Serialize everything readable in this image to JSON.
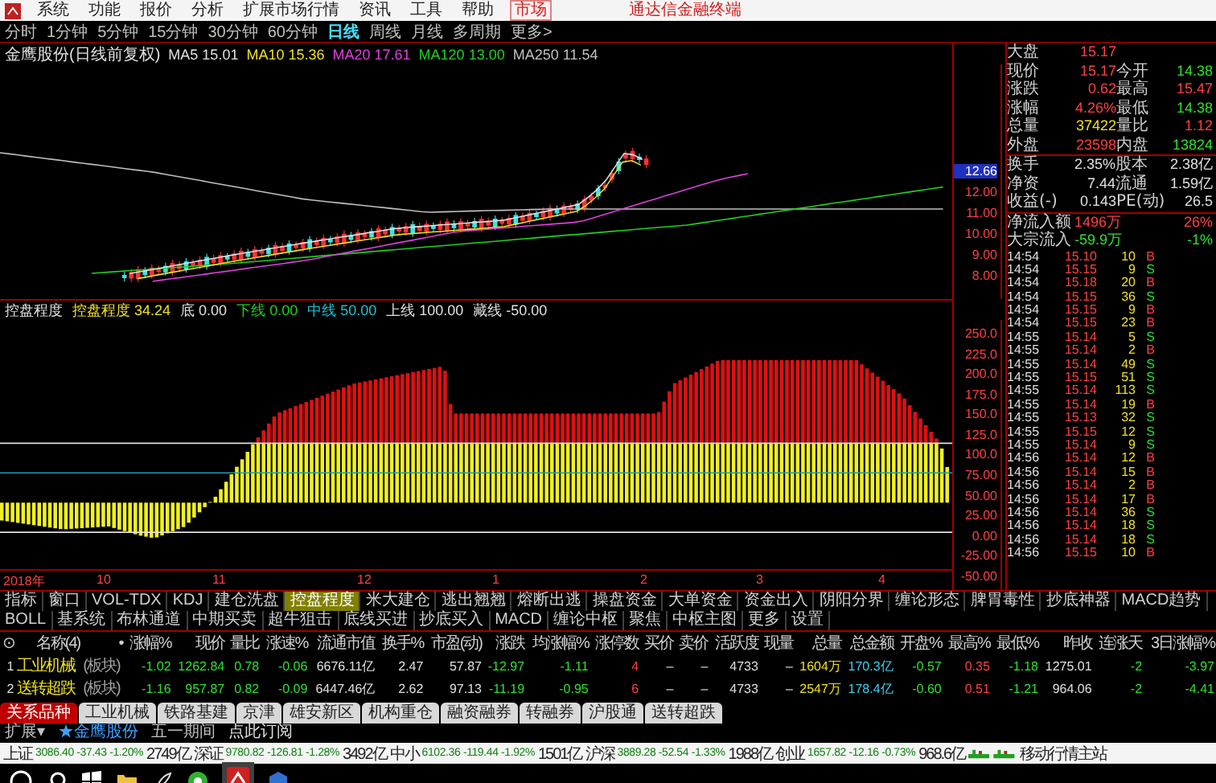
{
  "menu": {
    "items": [
      {
        "label": "系统",
        "selected": false
      },
      {
        "label": "功能",
        "selected": false
      },
      {
        "label": "报价",
        "selected": false
      },
      {
        "label": "分析",
        "selected": false
      },
      {
        "label": "扩展市场行情",
        "selected": false
      },
      {
        "label": "资讯",
        "selected": false
      },
      {
        "label": "工具",
        "selected": false
      },
      {
        "label": "帮助",
        "selected": false
      },
      {
        "label": "市场",
        "selected": true
      }
    ],
    "product": "通达信金融终端"
  },
  "periods": [
    {
      "label": "分时",
      "selected": false
    },
    {
      "label": "1分钟",
      "selected": false
    },
    {
      "label": "5分钟",
      "selected": false
    },
    {
      "label": "15分钟",
      "selected": false
    },
    {
      "label": "30分钟",
      "selected": false
    },
    {
      "label": "60分钟",
      "selected": false
    },
    {
      "label": "日线",
      "selected": true
    },
    {
      "label": "周线",
      "selected": false
    },
    {
      "label": "月线",
      "selected": false
    },
    {
      "label": "多周期",
      "selected": false
    },
    {
      "label": "更多>",
      "selected": false
    }
  ],
  "chart": {
    "title": "金鹰股份(日线前复权)",
    "mas": [
      {
        "label": "MA5 15.01",
        "color": "#e0e0e0"
      },
      {
        "label": "MA10 15.36",
        "color": "#f0e020"
      },
      {
        "label": "MA20 17.61",
        "color": "#e040e0"
      },
      {
        "label": "MA120 13.00",
        "color": "#20d020"
      },
      {
        "label": "MA250 11.54",
        "color": "#c0c0c0"
      }
    ],
    "axis": [
      {
        "label": "12.66",
        "selected": true
      },
      {
        "label": "12.00",
        "selected": false
      },
      {
        "label": "11.00",
        "selected": false
      },
      {
        "label": "10.00",
        "selected": false
      },
      {
        "label": "9.00",
        "selected": false
      },
      {
        "label": "8.00",
        "selected": false
      }
    ]
  },
  "indicator": {
    "name": "控盘程度",
    "lines": [
      {
        "label": "控盘程度 34.24",
        "color": "#f0e020"
      },
      {
        "label": "底 0.00",
        "color": "#e0e0e0"
      },
      {
        "label": "下线 0.00",
        "color": "#20d020"
      },
      {
        "label": "中线 50.00",
        "color": "#20c0d0"
      },
      {
        "label": "上线 100.00",
        "color": "#e0e0e0"
      },
      {
        "label": "藏线 -50.00",
        "color": "#e0e0e0"
      }
    ],
    "axis": [
      "250.0",
      "225.0",
      "200.0",
      "175.0",
      "150.0",
      "125.0",
      "100.0",
      "75.00",
      "50.00",
      "25.00",
      "0.00",
      "-25.00",
      "-50.00"
    ]
  },
  "dates": [
    "2018年",
    "10",
    "11",
    "12",
    "1",
    "2",
    "3",
    "4"
  ],
  "quote": {
    "rows": [
      {
        "cells": [
          {
            "label": "大盘",
            "value": "15.17",
            "color": "#ff4040"
          }
        ]
      },
      {
        "cells": [
          {
            "label": "现价",
            "value": "15.17",
            "color": "#ff4040"
          },
          {
            "label": "今开",
            "value": "14.38",
            "color": "#30e030"
          }
        ]
      },
      {
        "cells": [
          {
            "label": "涨跌",
            "value": "0.62",
            "color": "#ff4040"
          },
          {
            "label": "最高",
            "value": "15.47",
            "color": "#ff4040"
          }
        ]
      },
      {
        "cells": [
          {
            "label": "涨幅",
            "value": "4.26%",
            "color": "#ff4040"
          },
          {
            "label": "最低",
            "value": "14.38",
            "color": "#30e030"
          }
        ]
      },
      {
        "cells": [
          {
            "label": "总量",
            "value": "37422",
            "color": "#f0e020"
          },
          {
            "label": "量比",
            "value": "1.12",
            "color": "#ff4040"
          }
        ]
      },
      {
        "cells": [
          {
            "label": "外盘",
            "value": "23598",
            "color": "#ff4040"
          },
          {
            "label": "内盘",
            "value": "13824",
            "color": "#30e030"
          }
        ]
      },
      {
        "cells": [
          {
            "label": "换手",
            "value": "2.35%",
            "color": "#e0e0e0"
          },
          {
            "label": "股本",
            "value": "2.38亿",
            "color": "#e0e0e0"
          }
        ]
      },
      {
        "cells": [
          {
            "label": "净资",
            "value": "7.44",
            "color": "#e0e0e0"
          },
          {
            "label": "流通",
            "value": "1.59亿",
            "color": "#e0e0e0"
          }
        ]
      },
      {
        "cells": [
          {
            "label": "收益(-)",
            "value": "0.143",
            "color": "#e0e0e0"
          },
          {
            "label": "PE(动)",
            "value": "26.5",
            "color": "#e0e0e0"
          }
        ]
      },
      {
        "cells": [
          {
            "label": "净流入额",
            "value": "1496万",
            "color": "#ff4040"
          },
          {
            "value": "26%",
            "color": "#ff4040"
          }
        ]
      },
      {
        "cells": [
          {
            "label": "大宗流入",
            "value": "-59.9万",
            "color": "#30e030"
          },
          {
            "value": "-1%",
            "color": "#30e030"
          }
        ]
      }
    ],
    "ticks": [
      {
        "time": "14:54",
        "price": "15.10",
        "volume": "10",
        "side": "B",
        "kind": "buy"
      },
      {
        "time": "14:54",
        "price": "15.15",
        "volume": "9",
        "side": "S",
        "kind": "sell"
      },
      {
        "time": "14:54",
        "price": "15.18",
        "volume": "20",
        "side": "B",
        "kind": "buy"
      },
      {
        "time": "14:54",
        "price": "15.15",
        "volume": "36",
        "side": "S",
        "kind": "sell"
      },
      {
        "time": "14:54",
        "price": "15.15",
        "volume": "9",
        "side": "B",
        "kind": "buy"
      },
      {
        "time": "14:54",
        "price": "15.15",
        "volume": "23",
        "side": "B",
        "kind": "buy"
      },
      {
        "time": "14:55",
        "price": "15.14",
        "volume": "5",
        "side": "S",
        "kind": "sell"
      },
      {
        "time": "14:55",
        "price": "15.14",
        "volume": "2",
        "side": "B",
        "kind": "buy"
      },
      {
        "time": "14:55",
        "price": "15.14",
        "volume": "49",
        "side": "S",
        "kind": "sell"
      },
      {
        "time": "14:55",
        "price": "15.15",
        "volume": "51",
        "side": "S",
        "kind": "sell"
      },
      {
        "time": "14:55",
        "price": "15.14",
        "volume": "113",
        "side": "S",
        "kind": "sell"
      },
      {
        "time": "14:55",
        "price": "15.14",
        "volume": "19",
        "side": "B",
        "kind": "buy"
      },
      {
        "time": "14:55",
        "price": "15.13",
        "volume": "32",
        "side": "S",
        "kind": "sell"
      },
      {
        "time": "14:55",
        "price": "15.15",
        "volume": "12",
        "side": "S",
        "kind": "sell"
      },
      {
        "time": "14:55",
        "price": "15.14",
        "volume": "9",
        "side": "S",
        "kind": "sell"
      },
      {
        "time": "14:56",
        "price": "15.14",
        "volume": "12",
        "side": "B",
        "kind": "buy"
      },
      {
        "time": "14:56",
        "price": "15.14",
        "volume": "15",
        "side": "B",
        "kind": "buy"
      },
      {
        "time": "14:56",
        "price": "15.14",
        "volume": "2",
        "side": "B",
        "kind": "buy"
      },
      {
        "time": "14:56",
        "price": "15.14",
        "volume": "17",
        "side": "B",
        "kind": "buy"
      },
      {
        "time": "14:56",
        "price": "15.14",
        "volume": "36",
        "side": "S",
        "kind": "sell"
      },
      {
        "time": "14:56",
        "price": "15.14",
        "volume": "18",
        "side": "S",
        "kind": "sell"
      },
      {
        "time": "14:56",
        "price": "15.14",
        "volume": "18",
        "side": "S",
        "kind": "sell"
      },
      {
        "time": "14:56",
        "price": "15.15",
        "volume": "10",
        "side": "B",
        "kind": "buy"
      }
    ]
  },
  "indicator_tabs": [
    {
      "label": "指标",
      "selected": false
    },
    {
      "label": "窗口",
      "selected": false
    },
    {
      "label": "VOL-TDX",
      "selected": false
    },
    {
      "label": "KDJ",
      "selected": false
    },
    {
      "label": "建仓洗盘",
      "selected": false
    },
    {
      "label": "控盘程度",
      "selected": true
    },
    {
      "label": "米大建仓",
      "selected": false
    },
    {
      "label": "逃出翘翘",
      "selected": false
    },
    {
      "label": "熔断出逃",
      "selected": false
    },
    {
      "label": "操盘资金",
      "selected": false
    },
    {
      "label": "大单资金",
      "selected": false
    },
    {
      "label": "资金出入",
      "selected": false
    },
    {
      "label": "阴阳分界",
      "selected": false
    },
    {
      "label": "缠论形态",
      "selected": false
    },
    {
      "label": "脾胃毒性",
      "selected": false
    },
    {
      "label": "抄底神器",
      "selected": false
    },
    {
      "label": "MACD趋势",
      "selected": false
    },
    {
      "label": "BOLL",
      "selected": false
    },
    {
      "label": "基系统",
      "selected": false
    },
    {
      "label": "布林通道",
      "selected": false
    },
    {
      "label": "中期买卖",
      "selected": false
    },
    {
      "label": "超牛狙击",
      "selected": false
    },
    {
      "label": "底线买进",
      "selected": false
    },
    {
      "label": "抄底买入",
      "selected": false
    },
    {
      "label": "MACD",
      "selected": false
    },
    {
      "label": "缠论中枢",
      "selected": false
    },
    {
      "label": "聚焦",
      "selected": false
    },
    {
      "label": "中枢主图",
      "selected": false
    },
    {
      "label": "更多",
      "selected": false
    },
    {
      "label": "设置",
      "selected": false
    }
  ],
  "table": {
    "columns": [
      {
        "label": "⊙",
        "color": "#e0e0e0"
      },
      {
        "label": "名称(4)",
        "color": "#f0e020"
      },
      {
        "label": "•",
        "color": "#a0a0a0"
      },
      {
        "label": "涨幅%",
        "color": "#30e030"
      },
      {
        "label": "现价",
        "color": "#30e030"
      },
      {
        "label": "量比",
        "color": "#30e030"
      },
      {
        "label": "涨速%",
        "color": "#30e030"
      },
      {
        "label": "流通市值",
        "color": "#e0e0e0"
      },
      {
        "label": "换手%",
        "color": "#e0e0e0"
      },
      {
        "label": "市盈(动)",
        "color": "#e0e0e0"
      },
      {
        "label": "涨跌",
        "color": "#30e030"
      },
      {
        "label": "均涨幅%",
        "color": "#30e030"
      },
      {
        "label": "涨停数",
        "color": "#ff4040"
      },
      {
        "label": "买价"
      },
      {
        "label": "卖价"
      },
      {
        "label": "活跃度",
        "color": "#e0e0e0"
      },
      {
        "label": "现量"
      },
      {
        "label": "总量",
        "color": "#f0e020"
      },
      {
        "label": "总金额",
        "color": "#40d0f0"
      },
      {
        "label": "开盘%",
        "color": "#30e030"
      },
      {
        "label": "最高%",
        "color": "#ff4040"
      },
      {
        "label": "最低%",
        "color": "#30e030"
      },
      {
        "label": "昨收",
        "color": "#e0e0e0"
      },
      {
        "label": "连涨天",
        "color": "#30e030"
      },
      {
        "label": "3日涨幅%",
        "color": "#30e030"
      }
    ],
    "rows": [
      {
        "cells": [
          "1",
          "工业机械",
          "(板块)",
          "-1.02",
          "1262.84",
          "0.78",
          "-0.06",
          "6676.11亿",
          "2.47",
          "57.87",
          "-12.97",
          "-1.11",
          "4",
          "–",
          "–",
          "4733",
          "–",
          "1604万",
          "170.3亿",
          "-0.57",
          "0.35",
          "-1.18",
          "1275.01",
          "-2",
          "-3.97"
        ]
      },
      {
        "cells": [
          "2",
          "送转超跌",
          "(板块)",
          "-1.16",
          "957.87",
          "0.82",
          "-0.09",
          "6447.46亿",
          "2.62",
          "97.13",
          "-11.19",
          "-0.95",
          "6",
          "–",
          "–",
          "4733",
          "–",
          "2547万",
          "178.4亿",
          "-0.60",
          "0.51",
          "-1.21",
          "964.06",
          "-2",
          "-4.41"
        ]
      }
    ]
  },
  "block_tabs": [
    {
      "label": "关系品种",
      "selected": true
    },
    {
      "label": "工业机械",
      "selected": false
    },
    {
      "label": "铁路基建",
      "selected": false
    },
    {
      "label": "京津",
      "selected": false
    },
    {
      "label": "雄安新区",
      "selected": false
    },
    {
      "label": "机构重仓",
      "selected": false
    },
    {
      "label": "融资融券",
      "selected": false
    },
    {
      "label": "转融券",
      "selected": false
    },
    {
      "label": "沪股通",
      "selected": false
    },
    {
      "label": "送转超跌",
      "selected": false
    }
  ],
  "ext": {
    "label": "扩展▾",
    "stock": "★金鹰股份",
    "notice": "五一期间",
    "link": "点此订阅"
  },
  "indices": [
    {
      "name": "上证",
      "value": "3086.40",
      "change": "-37.43",
      "pct": "-1.20%",
      "amount": "2749亿",
      "color": "#108010"
    },
    {
      "name": "深证",
      "value": "9780.82",
      "change": "-126.81",
      "pct": "-1.28%",
      "amount": "3492亿",
      "color": "#108010"
    },
    {
      "name": "中小",
      "value": "6102.36",
      "change": "-119.44",
      "pct": "-1.92%",
      "amount": "1501亿",
      "color": "#108010"
    },
    {
      "name": "沪深",
      "value": "3889.28",
      "change": "-52.54",
      "pct": "-1.33%",
      "amount": "1988亿",
      "color": "#108010"
    },
    {
      "name": "创业",
      "value": "1657.82",
      "change": "-12.16",
      "pct": "-0.73%",
      "amount": "968.6亿",
      "color": "#108010"
    }
  ],
  "server": "移动行情主站"
}
